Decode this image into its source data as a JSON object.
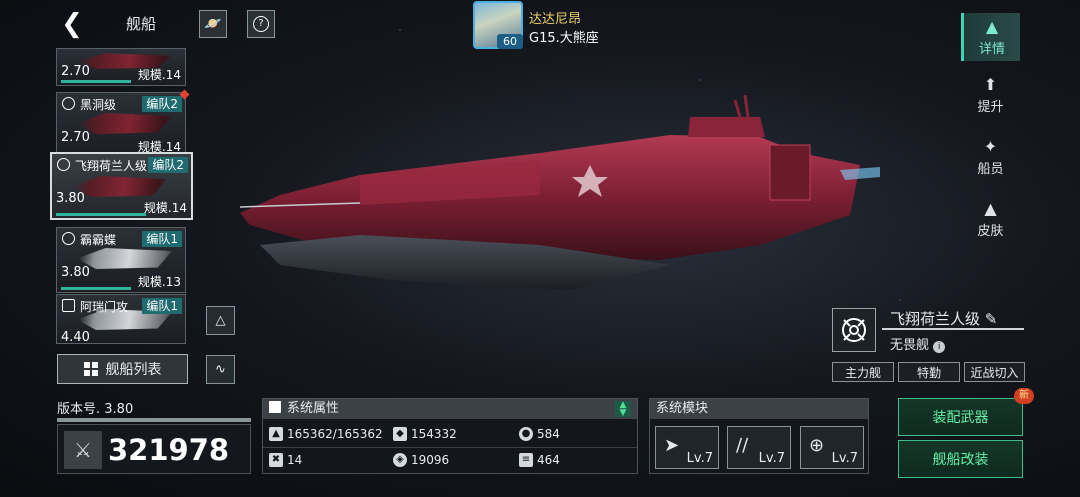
{
  "header": {
    "back_icon": "back-arrow-icon",
    "title": "舰船",
    "planet_icon": "planet-icon",
    "help_icon": "help-icon"
  },
  "commander": {
    "name": "达达尼昂",
    "level": "60",
    "location": "G15.大熊座"
  },
  "ship_list": [
    {
      "name": "",
      "fleet": "",
      "version": "2.70",
      "scale": "规模.14"
    },
    {
      "name": "黑洞级",
      "fleet": "编队2",
      "version": "2.70",
      "scale": "规模.14"
    },
    {
      "name": "飞翔荷兰人级",
      "fleet": "编队2",
      "version": "3.80",
      "scale": "规模.14"
    },
    {
      "name": "霸霸蝶",
      "fleet": "编队1",
      "version": "3.80",
      "scale": "规模.13"
    },
    {
      "name": "阿瑞门攻",
      "fleet": "编队1",
      "version": "4.40",
      "scale": ""
    }
  ],
  "ship_list_button": "舰船列表",
  "right_nav": [
    {
      "label": "详情",
      "icon": "detail-icon"
    },
    {
      "label": "提升",
      "icon": "upgrade-icon"
    },
    {
      "label": "船员",
      "icon": "crew-icon"
    },
    {
      "label": "皮肤",
      "icon": "skin-icon"
    }
  ],
  "ship": {
    "name": "飞翔荷兰人级",
    "class": "无畏舰",
    "tags": [
      "主力舰",
      "特勤",
      "近战切入"
    ]
  },
  "version": {
    "label": "版本号.",
    "value": "3.80"
  },
  "combat_power": "321978",
  "system_attributes": {
    "title": "系统属性",
    "stats": [
      {
        "icon": "hull-icon",
        "value": "165362/165362"
      },
      {
        "icon": "armor-icon",
        "value": "154332"
      },
      {
        "icon": "shield-icon",
        "value": "584"
      },
      {
        "icon": "energy-icon",
        "value": "14"
      },
      {
        "icon": "target-icon",
        "value": "19096"
      },
      {
        "icon": "speed-icon",
        "value": "464"
      }
    ]
  },
  "system_modules": {
    "title": "系统模块",
    "modules": [
      {
        "icon": "missile-module-icon",
        "level": "Lv.7"
      },
      {
        "icon": "cannon-module-icon",
        "level": "Lv.7"
      },
      {
        "icon": "radar-module-icon",
        "level": "Lv.7"
      }
    ]
  },
  "actions": {
    "equip_weapon": "装配武器",
    "modify_ship": "舰船改装",
    "new_badge": "新"
  }
}
